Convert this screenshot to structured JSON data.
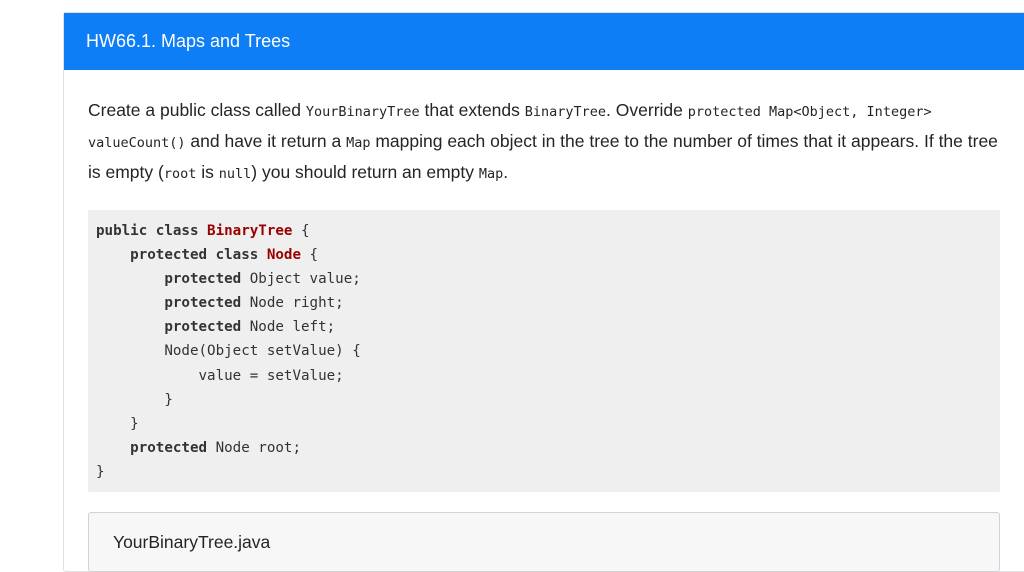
{
  "header": {
    "title": "HW66.1. Maps and Trees"
  },
  "prompt": {
    "t1": "Create a public class called ",
    "c1": "YourBinaryTree",
    "t2": " that extends ",
    "c2": "BinaryTree",
    "t3": ". Override ",
    "c3": "protected Map<Object, Integer> valueCount()",
    "t4": " and have it return a ",
    "c4": "Map",
    "t5": " mapping each object in the tree to the number of times that it appears. If the tree is empty (",
    "c5": "root",
    "t6": " is ",
    "c6": "null",
    "t7": ") you should return an empty ",
    "c7": "Map",
    "t8": "."
  },
  "code": {
    "l1_kw": "public class ",
    "l1_type": "BinaryTree",
    "l1_rest": " {",
    "l2_indent": "    ",
    "l2_kw": "protected class ",
    "l2_type": "Node",
    "l2_rest": " {",
    "l3_indent": "        ",
    "l3_kw": "protected",
    "l3_rest": " Object value;",
    "l4_indent": "        ",
    "l4_kw": "protected",
    "l4_rest": " Node right;",
    "l5_indent": "        ",
    "l5_kw": "protected",
    "l5_rest": " Node left;",
    "l6": "        Node(Object setValue) {",
    "l7": "            value = setValue;",
    "l8": "        }",
    "l9": "    }",
    "l10_indent": "    ",
    "l10_kw": "protected",
    "l10_rest": " Node root;",
    "l11": "}"
  },
  "editor": {
    "filename": "YourBinaryTree.java"
  }
}
